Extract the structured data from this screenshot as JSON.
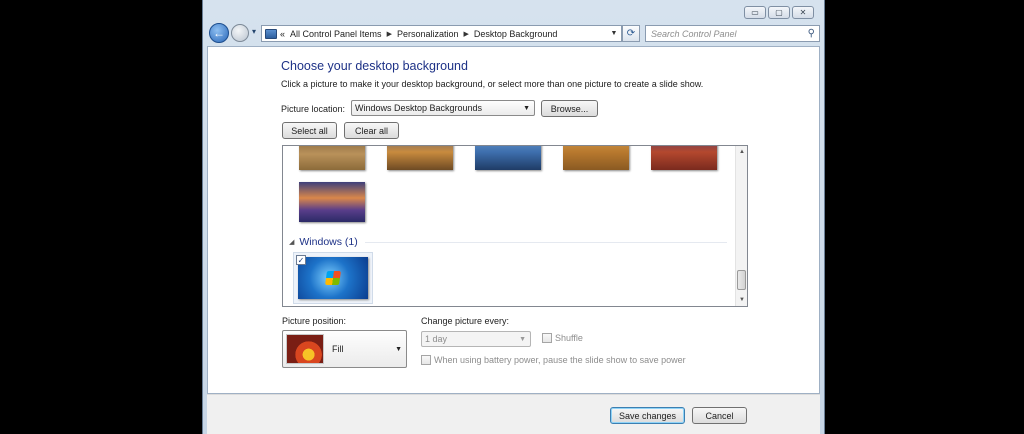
{
  "window": {
    "controls": {
      "minimize": "▭",
      "maximize": "▢",
      "close": "✕"
    }
  },
  "nav": {
    "back_glyph": "←",
    "history_glyph": "▾",
    "breadcrumb_overflow": "«",
    "breadcrumbs": [
      "All Control Panel Items",
      "Personalization",
      "Desktop Background"
    ],
    "refresh_glyph": "⟳",
    "search_placeholder": "Search Control Panel"
  },
  "header": {
    "title": "Choose your desktop background",
    "subtitle": "Click a picture to make it your desktop background, or select more than one picture to create a slide show."
  },
  "location": {
    "label": "Picture location:",
    "value": "Windows Desktop Backgrounds",
    "browse_label": "Browse..."
  },
  "actions": {
    "select_all": "Select all",
    "clear_all": "Clear all"
  },
  "gallery": {
    "group_label": "Windows (1)",
    "group_glyph": "◢",
    "check_glyph": "✓",
    "thumbnails_row1": [
      "landscape-1",
      "landscape-2",
      "lake-rock",
      "hay-bale",
      "red-arch"
    ],
    "thumbnails_row2": [
      "lavender-field"
    ],
    "windows_thumbnail": "windows-logo",
    "windows_checked": true
  },
  "position": {
    "label": "Picture position:",
    "value": "Fill"
  },
  "slideshow": {
    "interval_label": "Change picture every:",
    "interval_value": "1 day",
    "shuffle_label": "Shuffle",
    "battery_label": "When using battery power, pause the slide show to save power"
  },
  "footer": {
    "save_label": "Save changes",
    "cancel_label": "Cancel"
  },
  "colors": {
    "accent": "#1e3287",
    "window_frame": "#c7d6e6",
    "highlight": "#3399ff"
  }
}
